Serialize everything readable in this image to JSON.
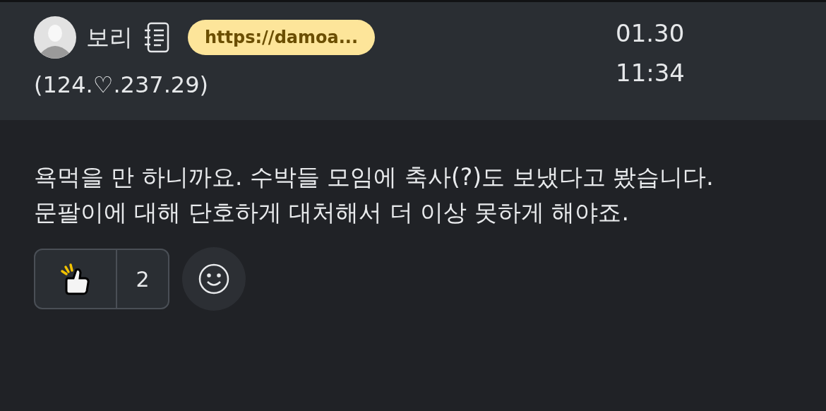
{
  "comment": {
    "author": "보리",
    "link": "https://damoa...",
    "ip": "(124.♡.237.29)",
    "date": "01.30",
    "time": "11:34",
    "paragraphs": [
      "욕먹을 만 하니까요. 수박들 모임에 축사(?)도 보냈다고 봤습니다.",
      "문팔이에 대해 단호하게 대처해서 더 이상 못하게 해야죠."
    ],
    "reactions": [
      {
        "count": "2"
      }
    ]
  }
}
